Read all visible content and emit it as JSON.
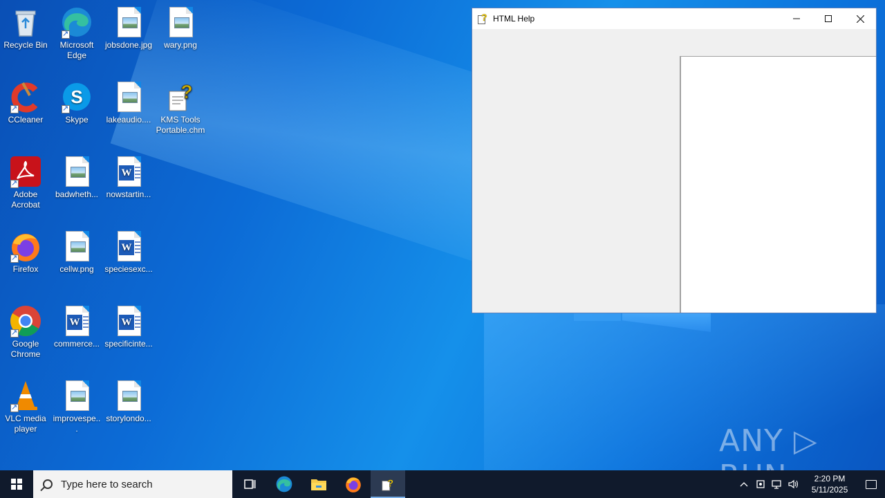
{
  "desktop": {
    "icons": [
      {
        "label": "Recycle Bin"
      },
      {
        "label": "Microsoft Edge"
      },
      {
        "label": "jobsdone.jpg"
      },
      {
        "label": "wary.png"
      },
      {
        "label": "CCleaner"
      },
      {
        "label": "Skype"
      },
      {
        "label": "lakeaudio...."
      },
      {
        "label": "KMS Tools Portable.chm"
      },
      {
        "label": "Adobe Acrobat"
      },
      {
        "label": "badwheth..."
      },
      {
        "label": "nowstartin..."
      },
      {
        "label": "Firefox"
      },
      {
        "label": "cellw.png"
      },
      {
        "label": "speciesexc..."
      },
      {
        "label": "Google Chrome"
      },
      {
        "label": "commerce..."
      },
      {
        "label": "specificinte..."
      },
      {
        "label": "VLC media player"
      },
      {
        "label": "improvespe..."
      },
      {
        "label": "storylondo..."
      }
    ]
  },
  "window": {
    "title": "HTML Help",
    "minimize": "—",
    "maximize": "☐",
    "close": "✕"
  },
  "watermark": "ANY ▷ RUN",
  "taskbar": {
    "search_placeholder": "Type here to search",
    "time": "2:20 PM",
    "date": "5/11/2025"
  },
  "colors": {
    "taskbar": "#101a2c",
    "desktop_accent": "#0c74dd"
  }
}
